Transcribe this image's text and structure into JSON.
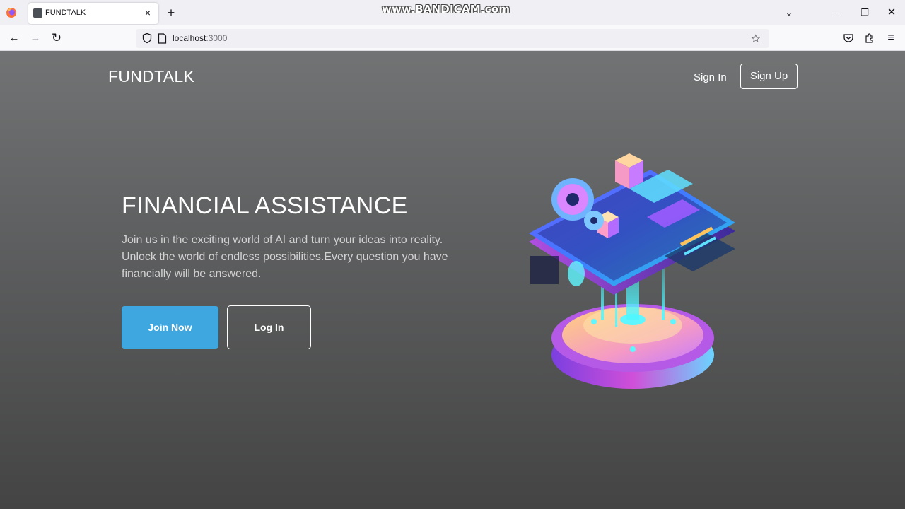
{
  "browser": {
    "tab_title": "FUNDTALK",
    "tab_close": "×",
    "new_tab": "+",
    "watermark": "www.BANDICAM.com",
    "url_host": "localhost",
    "url_port": ":3000",
    "icons": {
      "browser_logo": "firefox-icon",
      "back": "←",
      "forward": "→",
      "reload": "↻",
      "bookmark": "☆",
      "tabs_dropdown": "⌄",
      "minimize": "—",
      "restore": "❐",
      "close_window": "✕",
      "pocket": "pocket-icon",
      "extensions": "puzzle-icon",
      "menu": "≡"
    }
  },
  "header": {
    "brand": "FUNDTALK",
    "signin_label": "Sign In",
    "signup_label": "Sign Up"
  },
  "hero": {
    "title": "FINANCIAL ASSISTANCE",
    "description": "Join us in the exciting world of AI and turn your ideas into reality. Unlock the world of endless possibilities.Every question you have financially will be answered.",
    "join_label": "Join Now",
    "login_label": "Log In",
    "accent_color": "#3fa7df"
  }
}
